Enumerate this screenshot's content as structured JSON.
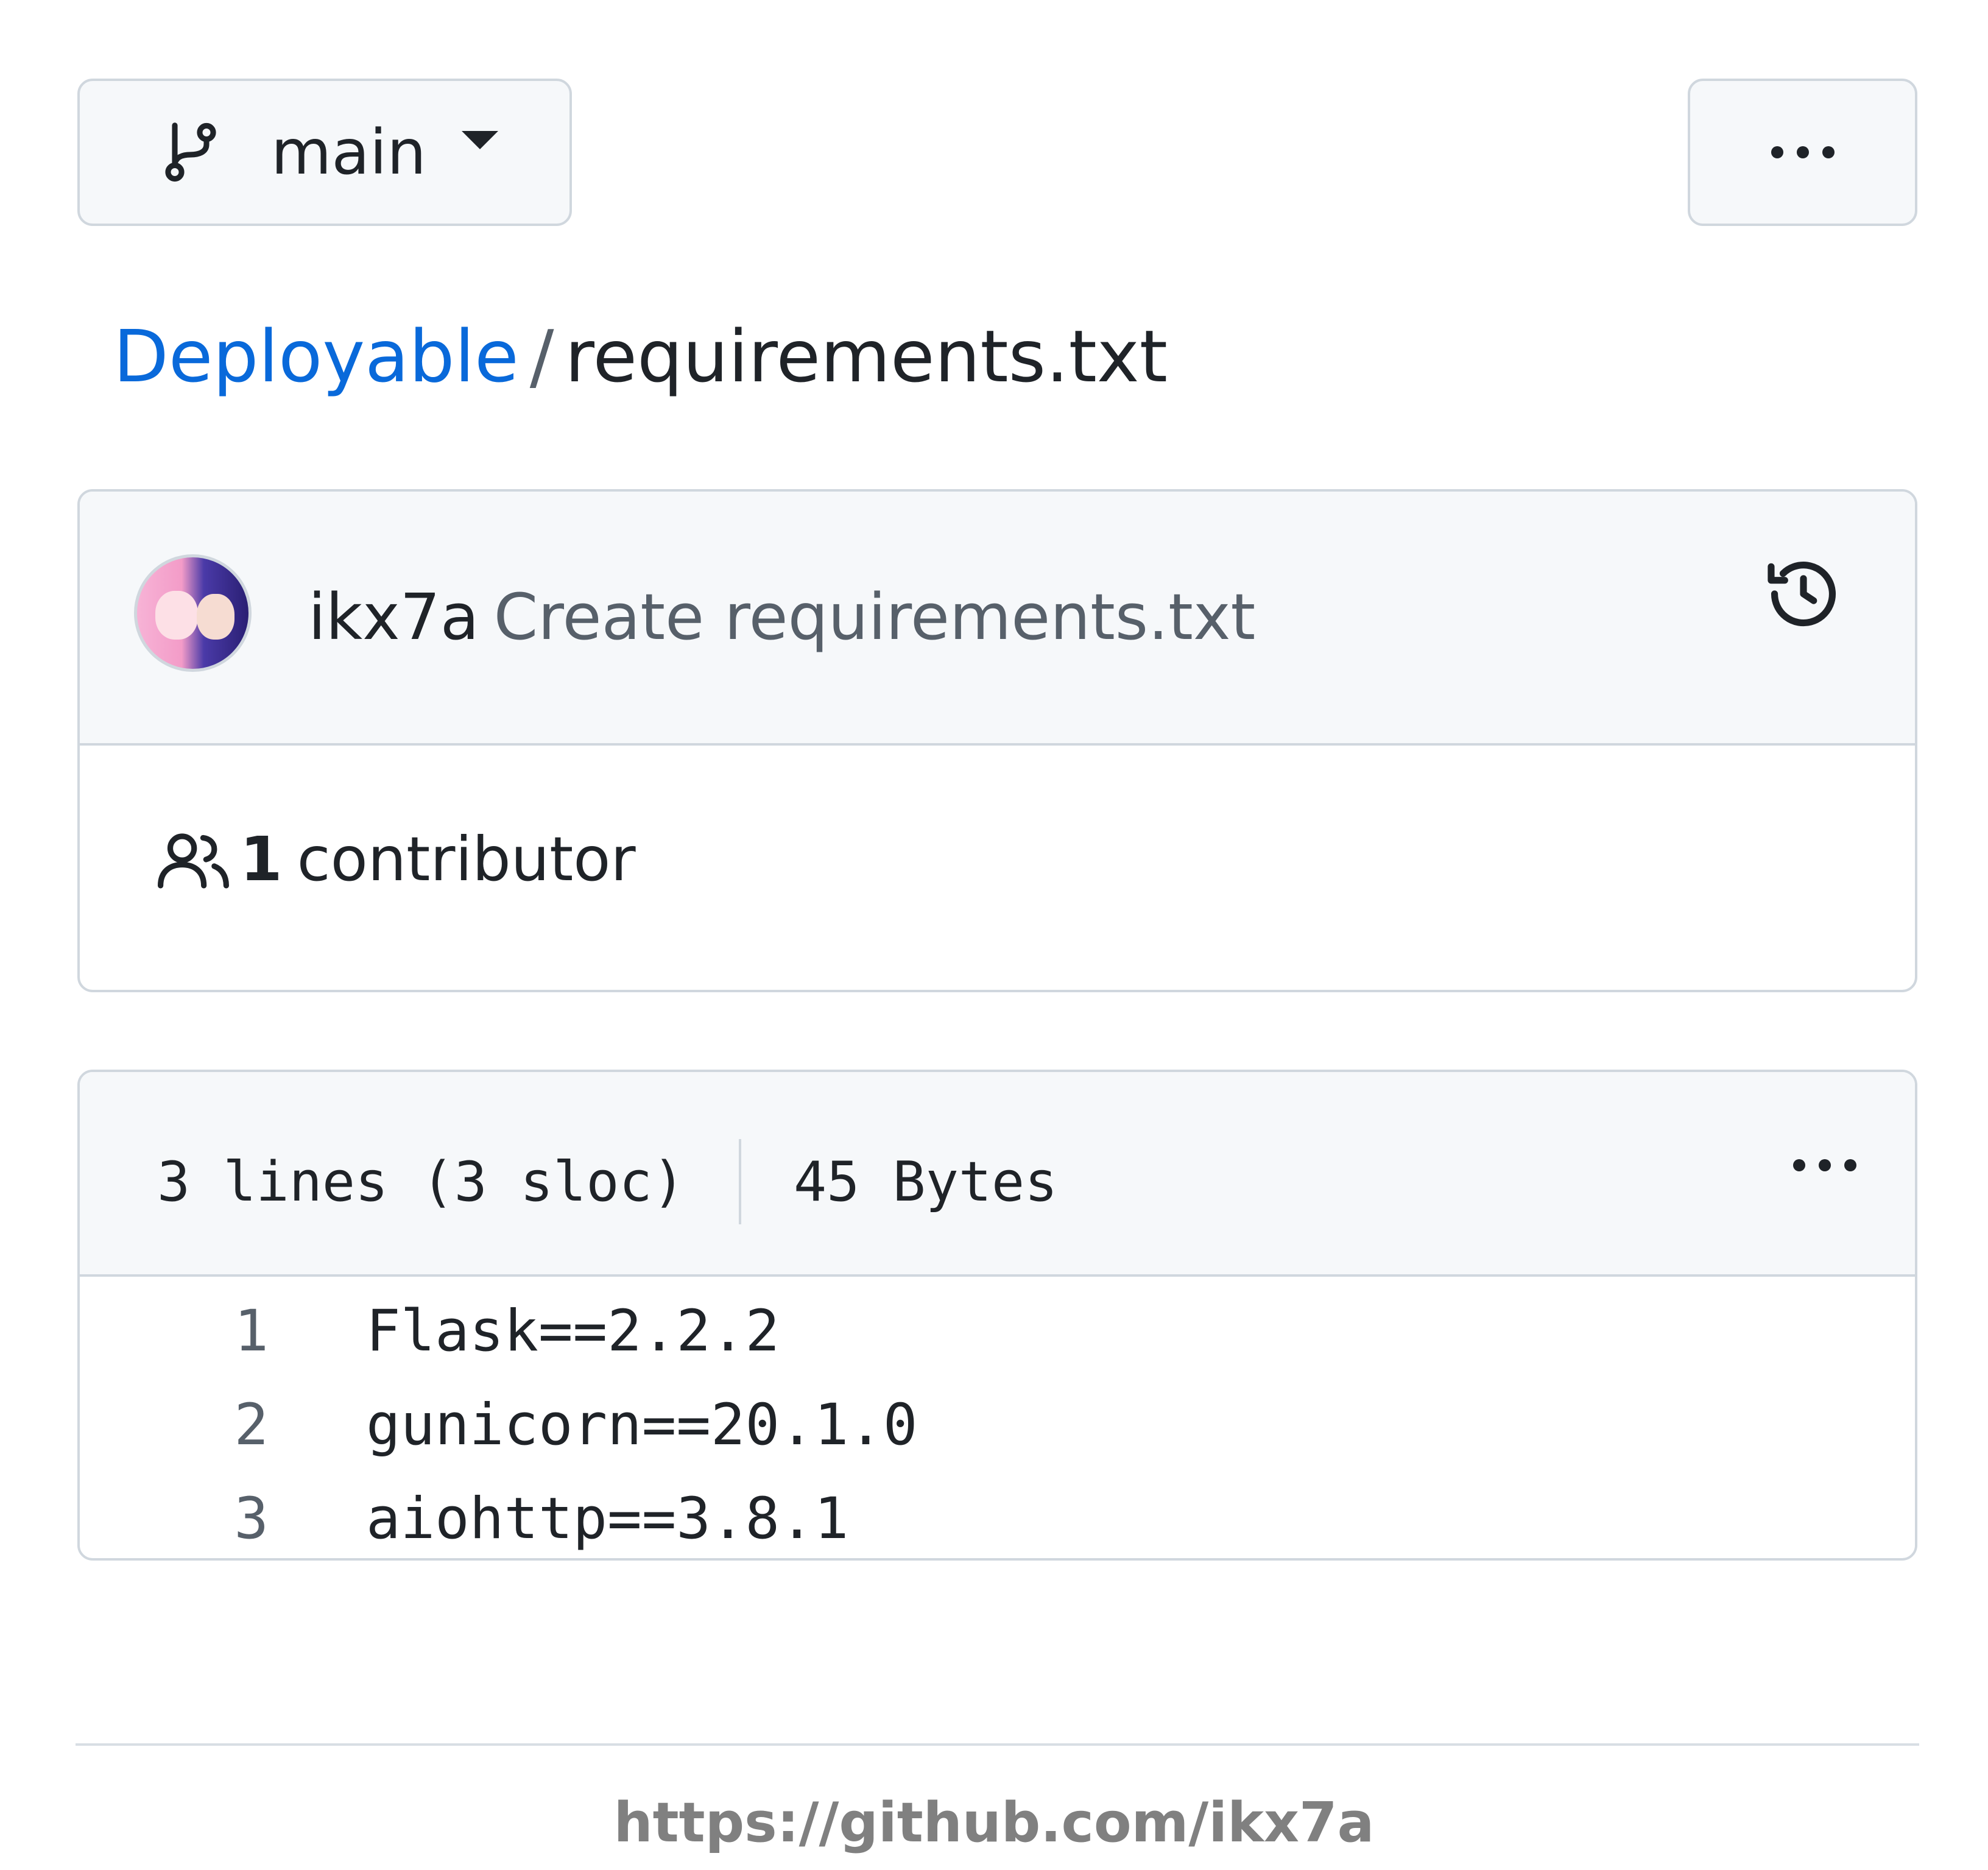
{
  "toolbar": {
    "branch_icon": "git-branch-icon",
    "branch_label": "main",
    "branch_caret": "triangle-down-icon",
    "more_icon": "kebab-horizontal-icon"
  },
  "breadcrumb": {
    "repo": "Deployable",
    "separator": "/",
    "file": "requirements.txt"
  },
  "commit": {
    "avatar_icon": "avatar",
    "author": "ikx7a",
    "message": "Create requirements.txt",
    "history_icon": "history-icon"
  },
  "contributors": {
    "icon": "people-icon",
    "count": "1",
    "label": "contributor"
  },
  "file": {
    "lines_info": "3 lines (3 sloc)",
    "size": "45 Bytes",
    "more_icon": "kebab-horizontal-icon",
    "lines": [
      {
        "num": "1",
        "code": "Flask==2.2.2"
      },
      {
        "num": "2",
        "code": "gunicorn==20.1.0"
      },
      {
        "num": "3",
        "code": "aiohttp==3.8.1"
      }
    ]
  },
  "footer": {
    "url": "https://github.com/ikx7a"
  },
  "colors": {
    "link": "#0969da",
    "text": "#1f2328",
    "muted": "#57606a",
    "border": "#d0d7de",
    "header_bg": "#f6f8fa"
  }
}
